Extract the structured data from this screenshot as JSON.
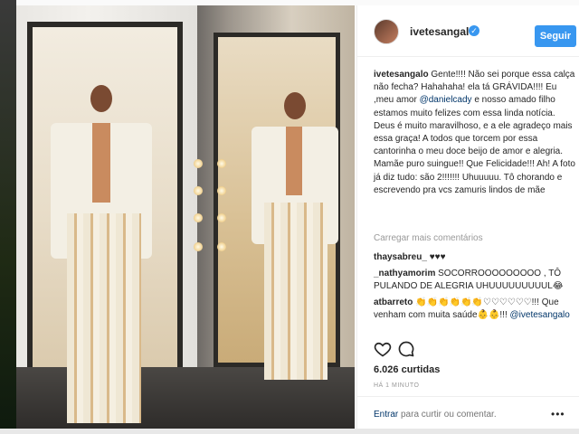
{
  "post": {
    "username": "ivetesangalo",
    "verified_icon": "verified-check-icon",
    "follow_label": "Seguir",
    "caption_user": "ivetesangalo",
    "caption_part1": "Gente!!!! Não sei porque essa calça não fecha? Hahahaha! ela tá GRÁVIDA!!!! Eu ,meu amor ",
    "caption_mention1": "@danielcady",
    "caption_part2": " e nosso amado filho estamos muito felizes com essa linda notícia. Deus é muito maravilhoso, e a ele agradeço mais essa graça! A todos que torcem por essa cantorinha o meu doce beijo de amor e alegria. Mamãe puro suingue!! Que Felicidade!!! Ah! A foto já diz tudo: são 2!!!!!!! Uhuuuuu. Tô chorando e escrevendo pra vcs zamuris lindos de mãe",
    "load_more": "Carregar mais comentários",
    "comments": [
      {
        "user": "thaysabreu_",
        "text": "♥♥♥"
      },
      {
        "user": "_nathyamorim",
        "text": "SOCORROOOOOOOOO , TÔ PULANDO DE ALEGRIA UHUUUUUUUUUL😂"
      },
      {
        "user": "atbarreto",
        "text": "👏👏👏👏👏👏♡♡♡♡♡♡!!! Que venham com muita saúde👶👶!!! ",
        "mention": "@ivetesangalo"
      }
    ],
    "likes": "6.026 curtidas",
    "time_ago": "HÁ 1 MINUTO",
    "enter_label": "Entrar",
    "comment_placeholder": "para curtir ou comentar.",
    "more_label": "•••"
  },
  "icons": {
    "like": "heart-icon",
    "comment": "speech-bubble-icon"
  },
  "colors": {
    "accent": "#3897f0",
    "text": "#262626",
    "muted": "#999999",
    "mention": "#003569"
  }
}
